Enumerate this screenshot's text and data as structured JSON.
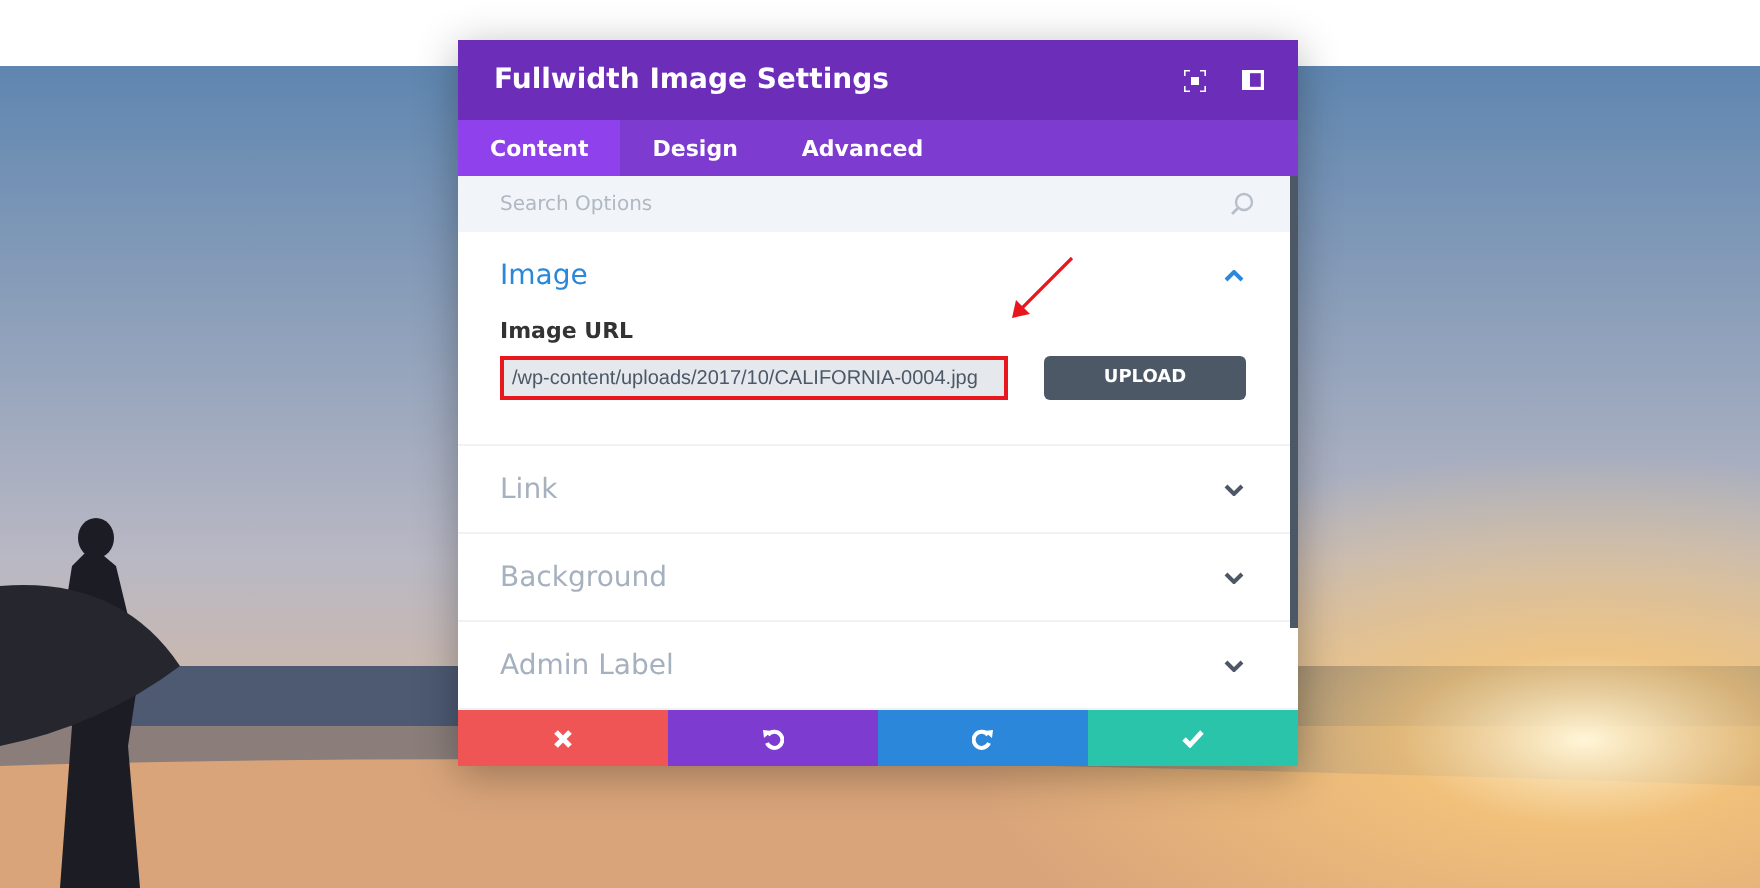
{
  "modal": {
    "title": "Fullwidth Image Settings",
    "tabs": [
      {
        "label": "Content",
        "selected": true
      },
      {
        "label": "Design",
        "selected": false
      },
      {
        "label": "Advanced",
        "selected": false
      }
    ],
    "search": {
      "placeholder": "Search Options"
    },
    "sections": [
      {
        "title": "Image",
        "expanded": true,
        "field_label": "Image URL",
        "field_value": "/wp-content/uploads/2017/10/CALIFORNIA-0004.jpg",
        "highlighted": true,
        "button": "UPLOAD"
      },
      {
        "title": "Link",
        "expanded": false
      },
      {
        "title": "Background",
        "expanded": false
      },
      {
        "title": "Admin Label",
        "expanded": false
      }
    ],
    "actions": [
      {
        "kind": "discard"
      },
      {
        "kind": "undo"
      },
      {
        "kind": "redo"
      },
      {
        "kind": "save"
      }
    ]
  }
}
